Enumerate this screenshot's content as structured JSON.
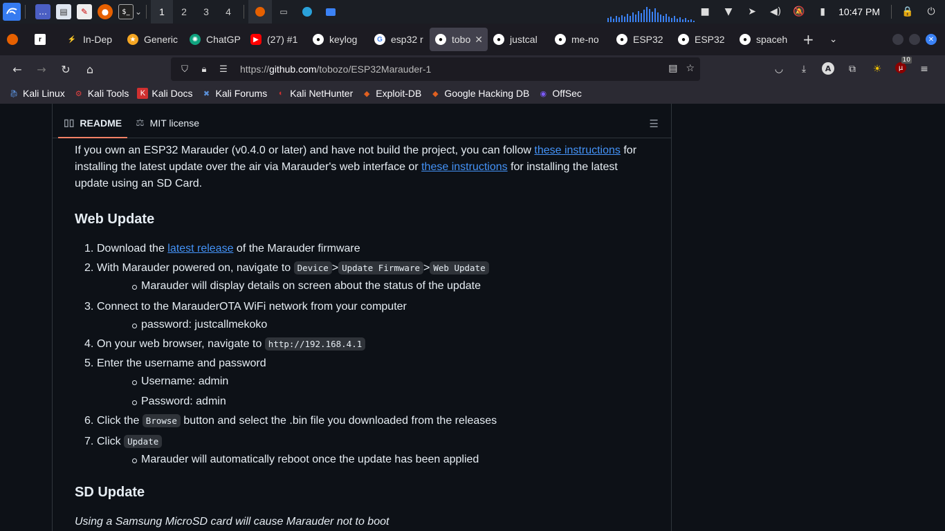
{
  "taskbar": {
    "workspaces": [
      "1",
      "2",
      "3",
      "4"
    ],
    "active_workspace": "1",
    "clock": "10:47 PM"
  },
  "tabs": [
    {
      "label": "In-Dep",
      "icon": "bolt-icon",
      "color": "#8a63f5"
    },
    {
      "label": "Generic",
      "icon": "star-icon",
      "color": "#f5a623"
    },
    {
      "label": "ChatGP",
      "icon": "chatgpt-icon",
      "color": "#10a37f"
    },
    {
      "label": "(27) #1",
      "icon": "youtube-icon",
      "color": "#ff0000"
    },
    {
      "label": "keylog",
      "icon": "github-icon",
      "color": "#ffffff"
    },
    {
      "label": "esp32 r",
      "icon": "google-icon",
      "color": "#4285f4"
    },
    {
      "label": "tobo",
      "icon": "github-icon",
      "color": "#ffffff",
      "active": true
    },
    {
      "label": "justcal",
      "icon": "github-icon",
      "color": "#ffffff"
    },
    {
      "label": "me-no",
      "icon": "github-icon",
      "color": "#ffffff"
    },
    {
      "label": "ESP32",
      "icon": "github-icon",
      "color": "#ffffff"
    },
    {
      "label": "ESP32",
      "icon": "github-icon",
      "color": "#ffffff"
    },
    {
      "label": "spaceh",
      "icon": "github-icon",
      "color": "#ffffff"
    }
  ],
  "address": {
    "scheme": "https://",
    "host": "github.com",
    "path": "/tobozo/ESP32Marauder-1"
  },
  "extensions_badge": "10",
  "bookmarks": [
    {
      "label": "Kali Linux",
      "color": "#5a8fd8"
    },
    {
      "label": "Kali Tools",
      "color": "#e04040"
    },
    {
      "label": "Kali Docs",
      "color": "#d03030"
    },
    {
      "label": "Kali Forums",
      "color": "#5a8fd8"
    },
    {
      "label": "Kali NetHunter",
      "color": "#d03030"
    },
    {
      "label": "Exploit-DB",
      "color": "#e06020"
    },
    {
      "label": "Google Hacking DB",
      "color": "#e06020"
    },
    {
      "label": "OffSec",
      "color": "#7a5af8"
    }
  ],
  "readme": {
    "tab_readme": "README",
    "tab_license": "MIT license",
    "intro_1": "If you own an ESP32 Marauder (v0.4.0 or later) and have not build the project, you can follow ",
    "intro_link1": "these instructions",
    "intro_2": " for installing the latest update over the air via Marauder's web interface or ",
    "intro_link2": "these instructions",
    "intro_3": " for installing the latest update using an SD Card.",
    "web_update_heading": "Web Update",
    "steps": {
      "s1_num": "1.",
      "s1_a": "Download the ",
      "s1_link": "latest release",
      "s1_b": " of the Marauder firmware",
      "s2_num": "2.",
      "s2_a": "With Marauder powered on, navigate to ",
      "s2_code1": "Device",
      "s2_sep1": ">",
      "s2_code2": "Update Firmware",
      "s2_sep2": ">",
      "s2_code3": "Web Update",
      "s2_sub": "Marauder will display details on screen about the status of the update",
      "s3_num": "3.",
      "s3_a": "Connect to the MarauderOTA WiFi network from your computer",
      "s3_sub": "password: justcallmekoko",
      "s4_num": "4.",
      "s4_a": "On your web browser, navigate to ",
      "s4_code": "http://192.168.4.1",
      "s5_num": "5.",
      "s5_a": "Enter the username and password",
      "s5_sub1": "Username: admin",
      "s5_sub2": "Password: admin",
      "s6_num": "6.",
      "s6_a": "Click the ",
      "s6_code": "Browse",
      "s6_b": " button and select the .bin file you downloaded from the releases",
      "s7_num": "7.",
      "s7_a": "Click ",
      "s7_code": "Update",
      "s7_sub": "Marauder will automatically reboot once the update has been applied"
    },
    "sd_update_heading": "SD Update",
    "sd_note": "Using a Samsung MicroSD card will cause Marauder not to boot"
  }
}
